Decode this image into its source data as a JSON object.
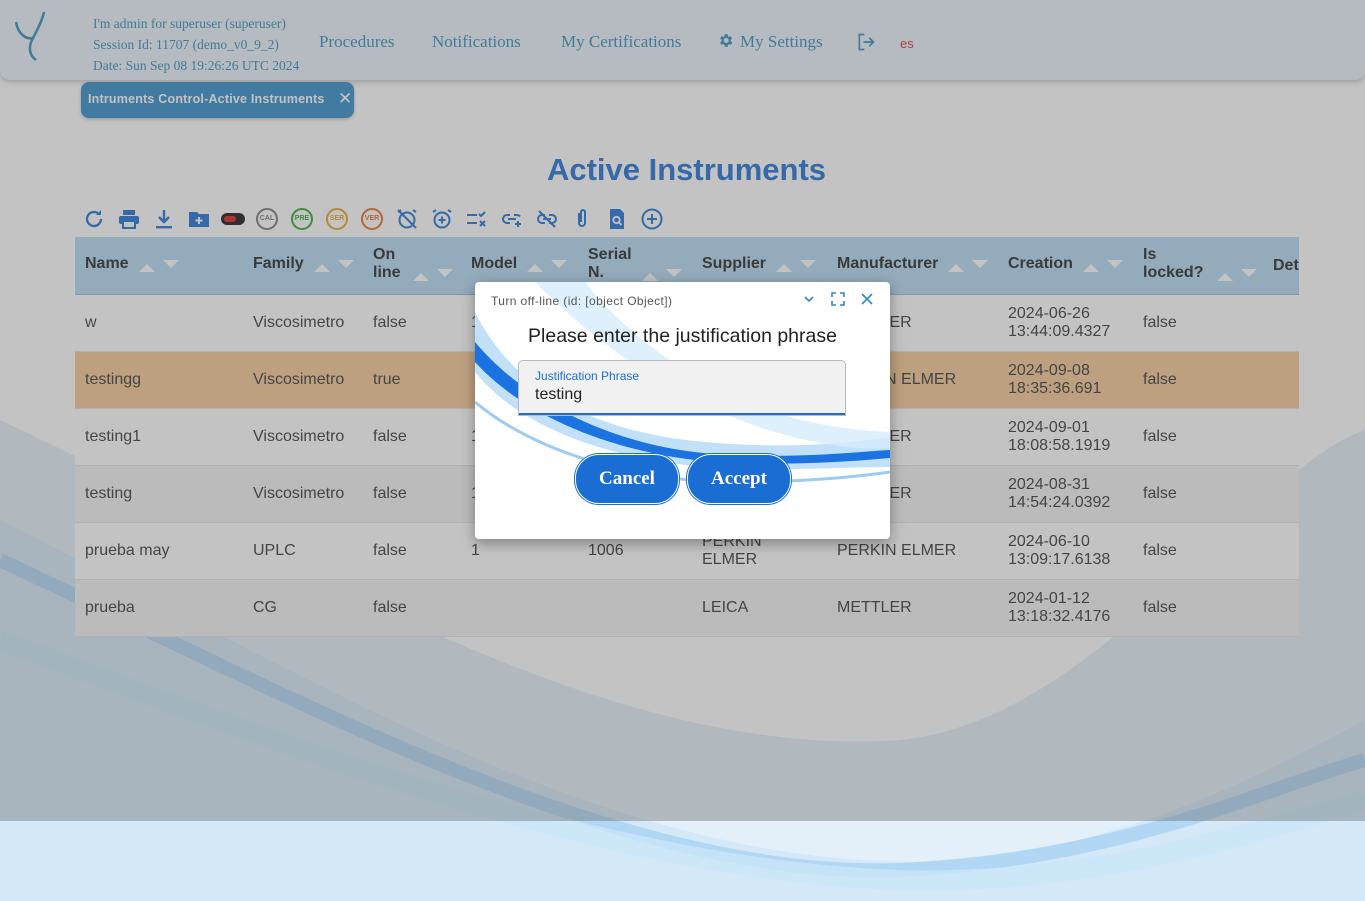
{
  "header": {
    "session_line1": "I'm admin for superuser (superuser)",
    "session_line2": "Session Id: 11707 (demo_v0_9_2)",
    "session_line3": "Date: Sun Sep 08 19:26:26 UTC 2024",
    "nav": {
      "procedures": "Procedures",
      "notifications": "Notifications",
      "certifications": "My Certifications",
      "settings": "My Settings"
    },
    "language": "es"
  },
  "tab": {
    "label": "Intruments Control-Active Instruments",
    "close": "✕"
  },
  "page_title": "Active Instruments",
  "toolbar": {
    "badges": [
      "CAL",
      "PRE",
      "SER",
      "VER"
    ]
  },
  "table": {
    "columns": [
      "Name",
      "Family",
      "On line",
      "Model",
      "Serial N.",
      "Supplier",
      "Manufacturer",
      "Creation",
      "Is locked?",
      "Det"
    ],
    "rows": [
      {
        "name": "w",
        "family": "Viscosimetro",
        "online": "false",
        "model": "1",
        "serial": "",
        "supplier": "",
        "manufacturer": "METTLER",
        "creation": "2024-06-26 13:44:09.4327",
        "locked": "false"
      },
      {
        "name": "testingg",
        "family": "Viscosimetro",
        "online": "true",
        "model": "",
        "serial": "",
        "supplier": "",
        "manufacturer": "PERKIN ELMER",
        "creation": "2024-09-08 18:35:36.691",
        "locked": "false"
      },
      {
        "name": "testing1",
        "family": "Viscosimetro",
        "online": "false",
        "model": "1",
        "serial": "",
        "supplier": "",
        "manufacturer": "METTLER",
        "creation": "2024-09-01 18:08:58.1919",
        "locked": "false"
      },
      {
        "name": "testing",
        "family": "Viscosimetro",
        "online": "false",
        "model": "1",
        "serial": "",
        "supplier": "",
        "manufacturer": "METTLER",
        "creation": "2024-08-31 14:54:24.0392",
        "locked": "false"
      },
      {
        "name": "prueba may",
        "family": "UPLC",
        "online": "false",
        "model": "1",
        "serial": "1006",
        "supplier": "PERKIN ELMER",
        "manufacturer": "PERKIN ELMER",
        "creation": "2024-06-10 13:09:17.6138",
        "locked": "false"
      },
      {
        "name": "prueba",
        "family": "CG",
        "online": "false",
        "model": "",
        "serial": "",
        "supplier": "LEICA",
        "manufacturer": "METTLER",
        "creation": "2024-01-12 13:18:32.4176",
        "locked": "false"
      }
    ]
  },
  "dialog": {
    "header": "Turn off-line (id: [object Object])",
    "prompt": "Please enter the justification phrase",
    "field_label": "Justification Phrase",
    "field_value": "testing",
    "cancel": "Cancel",
    "accept": "Accept"
  },
  "colors": {
    "accent": "#1a6ed3",
    "header_text": "#2f8ab8",
    "selected_row": "#f5c792",
    "table_header": "#b3d8f2"
  }
}
